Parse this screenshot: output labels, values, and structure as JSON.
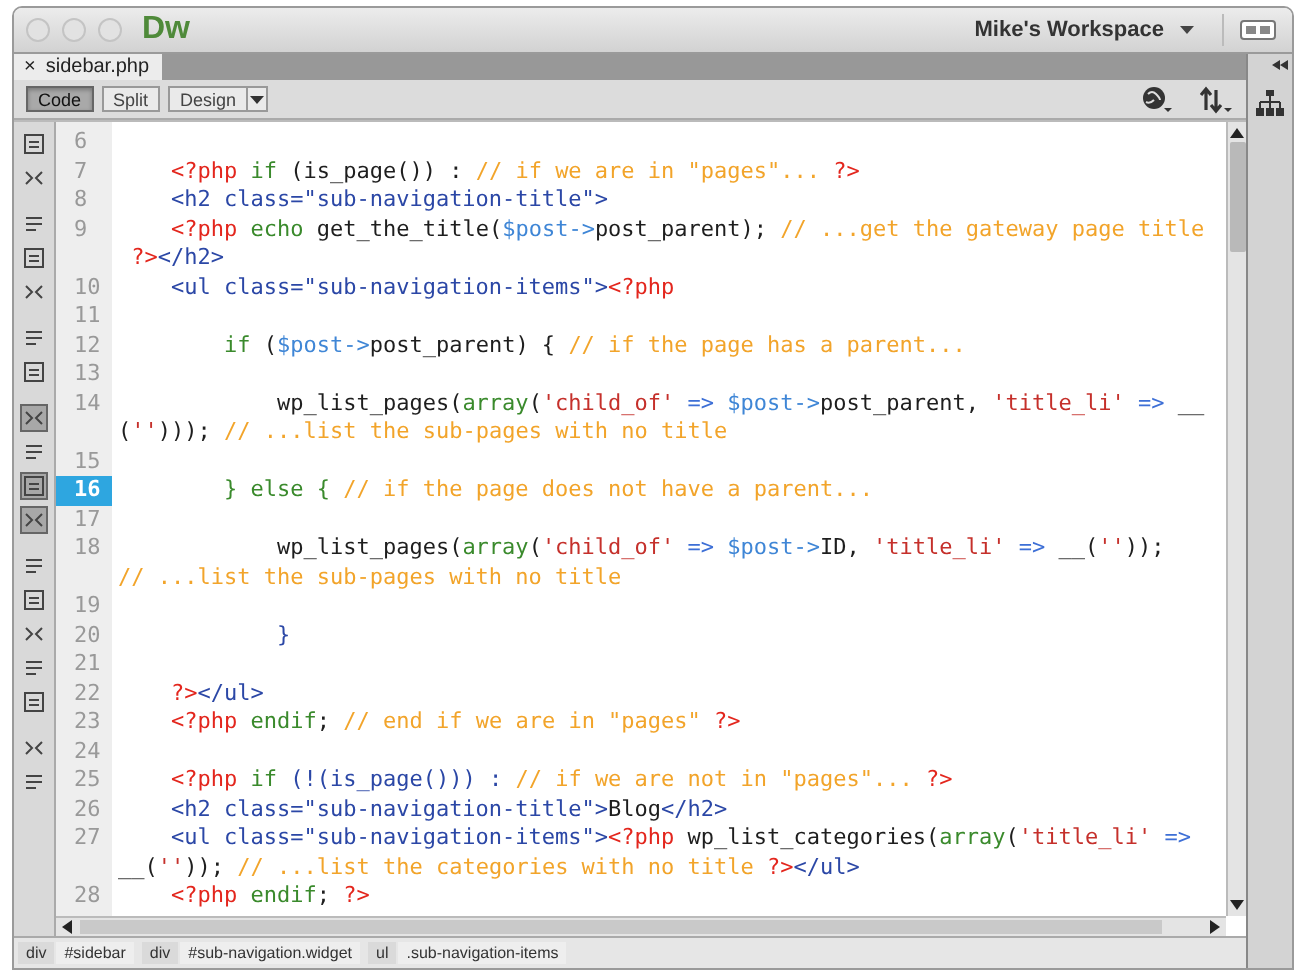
{
  "app": {
    "logo": "Dw",
    "workspace": "Mike's Workspace"
  },
  "document_tab": {
    "close": "×",
    "label": "sidebar.php"
  },
  "view_buttons": [
    {
      "label": "Code",
      "selected": true
    },
    {
      "label": "Split",
      "selected": false
    },
    {
      "label": "Design",
      "selected": false
    }
  ],
  "coding_toolbar": [
    {
      "pressed": false
    },
    {
      "pressed": false
    },
    {
      "pressed": false
    },
    {
      "pressed": false
    },
    {
      "pressed": false
    },
    {
      "pressed": false
    },
    {
      "pressed": false
    },
    {
      "pressed": true
    },
    {
      "pressed": false
    },
    {
      "pressed": true
    },
    {
      "pressed": true
    },
    {
      "pressed": false
    },
    {
      "pressed": false
    },
    {
      "pressed": false
    },
    {
      "pressed": false
    },
    {
      "pressed": false
    },
    {
      "pressed": false
    },
    {
      "pressed": false
    }
  ],
  "code_lines": [
    {
      "number": "6",
      "selected": false
    },
    {
      "number": "7",
      "selected": false,
      "tokens": [
        {
          "kind": "php",
          "text": "    <?php"
        },
        {
          "kind": "keyword",
          "text": " if"
        },
        {
          "kind": "plain",
          "text": " (is_page()) : "
        },
        {
          "kind": "comment",
          "text": "// if we are in \"pages\"... "
        },
        {
          "kind": "php",
          "text": "?>"
        }
      ]
    },
    {
      "number": "8",
      "selected": false,
      "tokens": [
        {
          "kind": "tag",
          "text": "    <h2 class=\"sub-navigation-title\">"
        }
      ]
    },
    {
      "number": "9",
      "selected": false,
      "tokens": [
        {
          "kind": "php",
          "text": "    <?php"
        },
        {
          "kind": "keyword",
          "text": " echo"
        },
        {
          "kind": "plain",
          "text": " get_the_title("
        },
        {
          "kind": "variable",
          "text": "$post->"
        },
        {
          "kind": "plain",
          "text": "post_parent); "
        },
        {
          "kind": "comment",
          "text": "// ...get the gateway page title"
        }
      ]
    },
    {
      "selected": false,
      "tokens": [
        {
          "kind": "php",
          "text": " ?>"
        },
        {
          "kind": "tag",
          "text": "</h2>"
        }
      ]
    },
    {
      "number": "10",
      "selected": false,
      "tokens": [
        {
          "kind": "tag",
          "text": "    <ul class=\"sub-navigation-items\">"
        },
        {
          "kind": "php",
          "text": "<?php"
        }
      ]
    },
    {
      "number": "11",
      "selected": false
    },
    {
      "number": "12",
      "selected": false,
      "tokens": [
        {
          "kind": "keyword",
          "text": "        if"
        },
        {
          "kind": "plain",
          "text": " ("
        },
        {
          "kind": "variable",
          "text": "$post->"
        },
        {
          "kind": "plain",
          "text": "post_parent) { "
        },
        {
          "kind": "comment",
          "text": "// if the page has a parent..."
        }
      ]
    },
    {
      "number": "13",
      "selected": false
    },
    {
      "number": "14",
      "selected": false,
      "tokens": [
        {
          "kind": "plain",
          "text": "            wp_list_pages("
        },
        {
          "kind": "keyword",
          "text": "array"
        },
        {
          "kind": "plain",
          "text": "("
        },
        {
          "kind": "string",
          "text": "'child_of'"
        },
        {
          "kind": "operator",
          "text": " => "
        },
        {
          "kind": "variable",
          "text": "$post->"
        },
        {
          "kind": "plain",
          "text": "post_parent, "
        },
        {
          "kind": "string",
          "text": "'title_li'"
        },
        {
          "kind": "operator",
          "text": " => "
        },
        {
          "kind": "plain",
          "text": "__"
        }
      ]
    },
    {
      "selected": false,
      "tokens": [
        {
          "kind": "plain",
          "text": "("
        },
        {
          "kind": "string",
          "text": "''"
        },
        {
          "kind": "plain",
          "text": "))); "
        },
        {
          "kind": "comment",
          "text": "// ...list the sub-pages with no title"
        }
      ]
    },
    {
      "number": "15",
      "selected": false
    },
    {
      "number": "16",
      "selected": true,
      "tokens": [
        {
          "kind": "keyword",
          "text": "        } else { "
        },
        {
          "kind": "comment",
          "text": "// if the page does not have a parent..."
        }
      ]
    },
    {
      "number": "17",
      "selected": false
    },
    {
      "number": "18",
      "selected": false,
      "tokens": [
        {
          "kind": "plain",
          "text": "            wp_list_pages("
        },
        {
          "kind": "keyword",
          "text": "array"
        },
        {
          "kind": "plain",
          "text": "("
        },
        {
          "kind": "string",
          "text": "'child_of'"
        },
        {
          "kind": "operator",
          "text": " => "
        },
        {
          "kind": "variable",
          "text": "$post->"
        },
        {
          "kind": "plain",
          "text": "ID, "
        },
        {
          "kind": "string",
          "text": "'title_li'"
        },
        {
          "kind": "operator",
          "text": " => "
        },
        {
          "kind": "plain",
          "text": "__("
        },
        {
          "kind": "string",
          "text": "''"
        },
        {
          "kind": "plain",
          "text": "));"
        }
      ]
    },
    {
      "selected": false,
      "tokens": [
        {
          "kind": "comment",
          "text": "// ...list the sub-pages with no title"
        }
      ]
    },
    {
      "number": "19",
      "selected": false
    },
    {
      "number": "20",
      "selected": false,
      "tokens": [
        {
          "kind": "tag",
          "text": "            }"
        }
      ]
    },
    {
      "number": "21",
      "selected": false
    },
    {
      "number": "22",
      "selected": false,
      "tokens": [
        {
          "kind": "php",
          "text": "    ?>"
        },
        {
          "kind": "tag",
          "text": "</ul>"
        }
      ]
    },
    {
      "number": "23",
      "selected": false,
      "tokens": [
        {
          "kind": "php",
          "text": "    <?php"
        },
        {
          "kind": "keyword",
          "text": " endif"
        },
        {
          "kind": "plain",
          "text": "; "
        },
        {
          "kind": "comment",
          "text": "// end if we are in \"pages\" "
        },
        {
          "kind": "php",
          "text": "?>"
        }
      ]
    },
    {
      "number": "24",
      "selected": false
    },
    {
      "number": "25",
      "selected": false,
      "tokens": [
        {
          "kind": "php",
          "text": "    <?php"
        },
        {
          "kind": "keyword",
          "text": " if"
        },
        {
          "kind": "tag",
          "text": " (!(is_page())) : "
        },
        {
          "kind": "comment",
          "text": "// if we are not in \"pages\"... "
        },
        {
          "kind": "php",
          "text": "?>"
        }
      ]
    },
    {
      "number": "26",
      "selected": false,
      "tokens": [
        {
          "kind": "tag",
          "text": "    <h2 class=\"sub-navigation-title\">"
        },
        {
          "kind": "plain",
          "text": "Blog"
        },
        {
          "kind": "tag",
          "text": "</h2>"
        }
      ]
    },
    {
      "number": "27",
      "selected": false,
      "tokens": [
        {
          "kind": "tag",
          "text": "    <ul class=\"sub-navigation-items\">"
        },
        {
          "kind": "php",
          "text": "<?php"
        },
        {
          "kind": "plain",
          "text": " wp_list_categories("
        },
        {
          "kind": "keyword",
          "text": "array"
        },
        {
          "kind": "plain",
          "text": "("
        },
        {
          "kind": "string",
          "text": "'title_li'"
        },
        {
          "kind": "operator",
          "text": " =>"
        }
      ]
    },
    {
      "selected": false,
      "tokens": [
        {
          "kind": "plain",
          "text": "__("
        },
        {
          "kind": "string",
          "text": "''"
        },
        {
          "kind": "plain",
          "text": ")); "
        },
        {
          "kind": "comment",
          "text": "// ...list the categories with no title "
        },
        {
          "kind": "php",
          "text": "?>"
        },
        {
          "kind": "tag",
          "text": "</ul>"
        }
      ]
    },
    {
      "number": "28",
      "selected": false,
      "tokens": [
        {
          "kind": "php",
          "text": "    <?php"
        },
        {
          "kind": "keyword",
          "text": " endif"
        },
        {
          "kind": "plain",
          "text": "; "
        },
        {
          "kind": "php",
          "text": "?>"
        }
      ]
    }
  ],
  "tag_selector": [
    {
      "tag": "div",
      "id": "#sidebar"
    },
    {
      "tag": "div",
      "id": "#sub-navigation.widget"
    },
    {
      "tag": "ul",
      "id": ".sub-navigation-items"
    }
  ]
}
